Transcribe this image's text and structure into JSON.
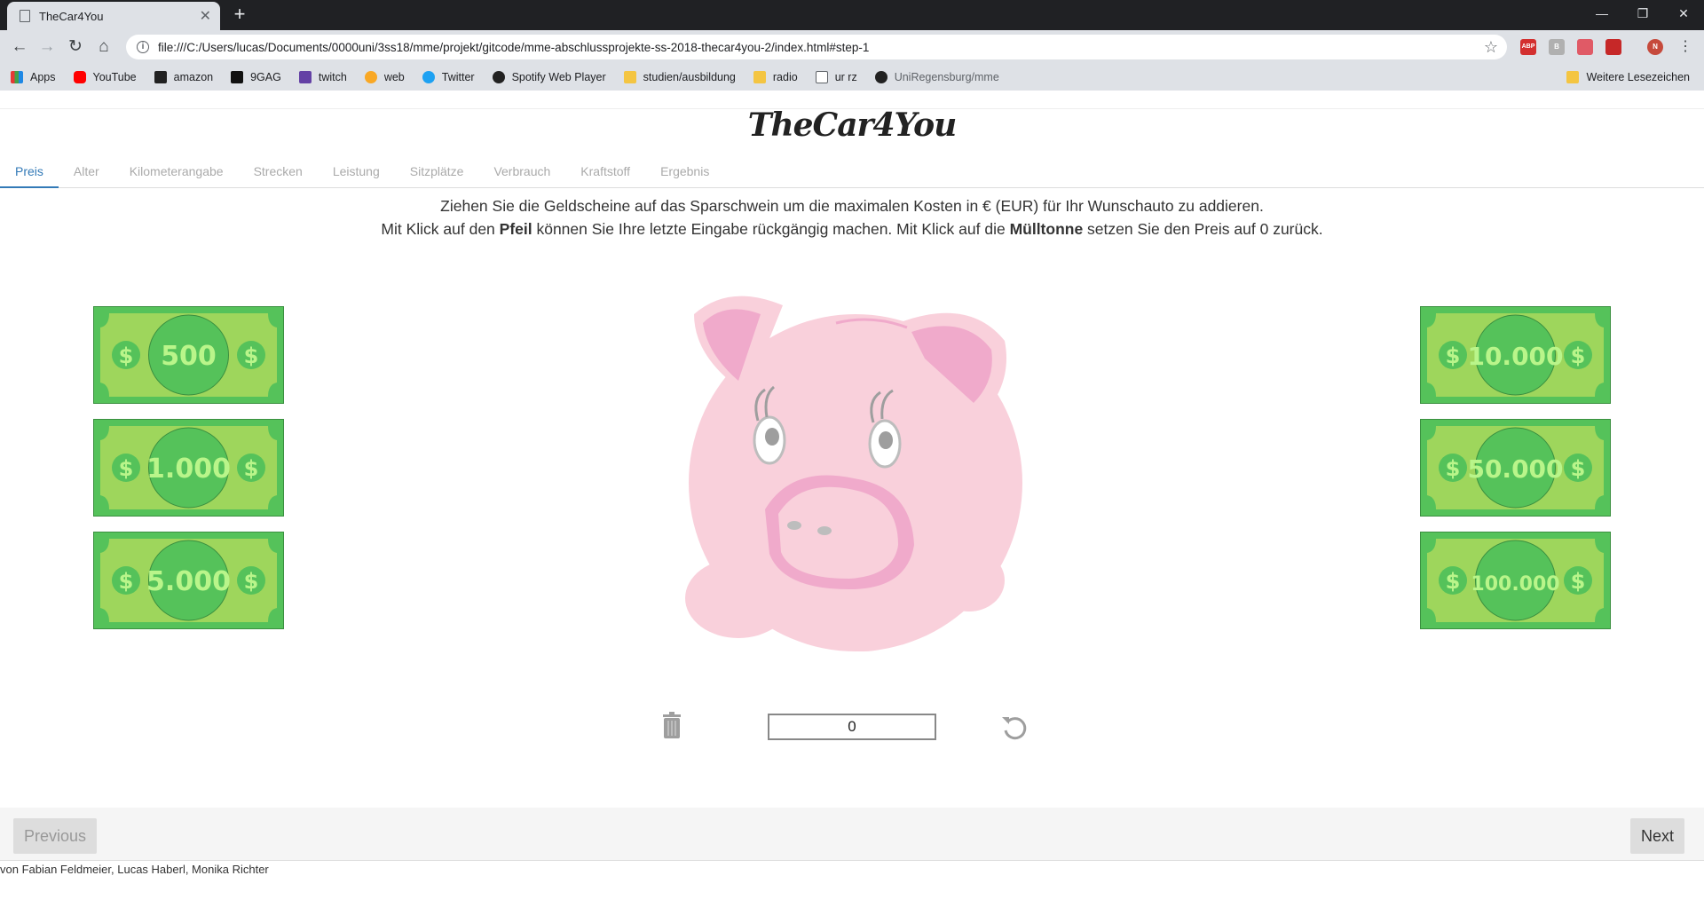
{
  "browser": {
    "tab_title": "TheCar4You",
    "new_tab": "+",
    "url": "file:///C:/Users/lucas/Documents/0000uni/3ss18/mme/projekt/gitcode/mme-abschlussprojekte-ss-2018-thecar4you-2/index.html#step-1",
    "bookmarks": [
      "Apps",
      "YouTube",
      "amazon",
      "9GAG",
      "twitch",
      "web",
      "Twitter",
      "Spotify Web Player",
      "studien/ausbildung",
      "radio",
      "ur rz",
      "UniRegensburg/mme"
    ],
    "bookmarks_other": "Weitere Lesezeichen",
    "extensions": [
      "ABP",
      "B",
      "N"
    ]
  },
  "header": {
    "logo": "TheCar4You"
  },
  "steps": [
    {
      "label": "Preis",
      "active": true
    },
    {
      "label": "Alter"
    },
    {
      "label": "Kilometerangabe"
    },
    {
      "label": "Strecken"
    },
    {
      "label": "Leistung"
    },
    {
      "label": "Sitzplätze"
    },
    {
      "label": "Verbrauch"
    },
    {
      "label": "Kraftstoff"
    },
    {
      "label": "Ergebnis"
    }
  ],
  "instructions": {
    "line1": "Ziehen Sie die Geldscheine auf das Sparschwein um die maximalen Kosten in € (EUR) für Ihr Wunschauto zu addieren.",
    "line2_a": "Mit Klick auf den ",
    "line2_b": "Pfeil",
    "line2_c": " können Sie Ihre letzte Eingabe rückgängig machen. Mit Klick auf die ",
    "line2_d": "Mülltonne",
    "line2_e": " setzen Sie den Preis auf 0 zurück."
  },
  "bills_left": [
    "500",
    "1.000",
    "5.000"
  ],
  "bills_right": [
    "10.000",
    "50.000",
    "100.000"
  ],
  "bill_symbol": "$",
  "sum": "0",
  "nav": {
    "previous": "Previous",
    "next": "Next"
  },
  "footer": "von Fabian Feldmeier, Lucas Haberl, Monika Richter",
  "colors": {
    "accent": "#337ab7",
    "bill_dark": "#55c25a",
    "bill_light": "#9ed65c",
    "pig": "#f9d0db",
    "pig_dark": "#f0aacb"
  }
}
